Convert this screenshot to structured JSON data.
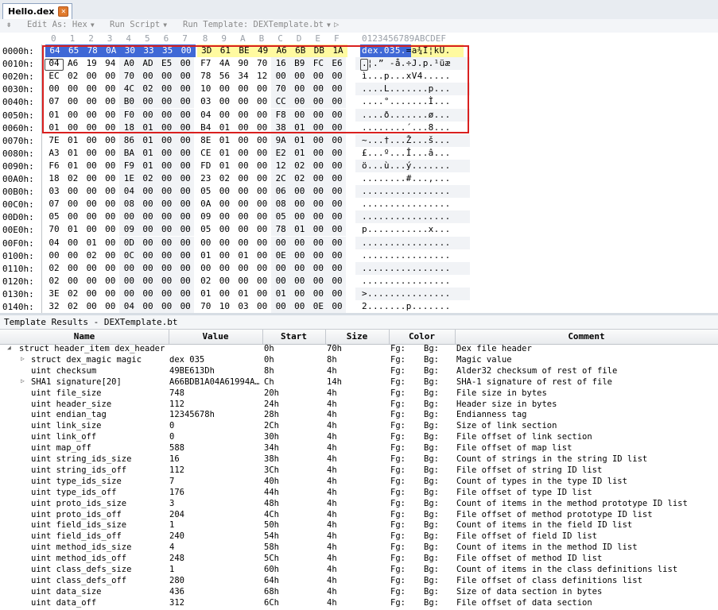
{
  "tab": {
    "title": "Hello.dex"
  },
  "toolbar": {
    "edit_as": "Edit As: Hex",
    "run_script": "Run Script",
    "run_template": "Run Template: DEXTemplate.bt"
  },
  "hex": {
    "column_headers": [
      "0",
      "1",
      "2",
      "3",
      "4",
      "5",
      "6",
      "7",
      "8",
      "9",
      "A",
      "B",
      "C",
      "D",
      "E",
      "F"
    ],
    "ascii_header": "0123456789ABCDEF",
    "rows": [
      {
        "addr": "0000h:",
        "bytes": [
          "64",
          "65",
          "78",
          "0A",
          "30",
          "33",
          "35",
          "00",
          "3D",
          "61",
          "BE",
          "49",
          "A6",
          "6B",
          "DB",
          "1A"
        ],
        "ascii": "dex.035.=a¾I¦kÛ."
      },
      {
        "addr": "0010h:",
        "bytes": [
          "04",
          "A6",
          "19",
          "94",
          "A0",
          "AD",
          "E5",
          "00",
          "F7",
          "4A",
          "90",
          "70",
          "16",
          "B9",
          "FC",
          "E6"
        ],
        "ascii": ".¦.” -å.÷J.p.¹üæ"
      },
      {
        "addr": "0020h:",
        "bytes": [
          "EC",
          "02",
          "00",
          "00",
          "70",
          "00",
          "00",
          "00",
          "78",
          "56",
          "34",
          "12",
          "00",
          "00",
          "00",
          "00"
        ],
        "ascii": "ì...p...xV4....."
      },
      {
        "addr": "0030h:",
        "bytes": [
          "00",
          "00",
          "00",
          "00",
          "4C",
          "02",
          "00",
          "00",
          "10",
          "00",
          "00",
          "00",
          "70",
          "00",
          "00",
          "00"
        ],
        "ascii": "....L.......p..."
      },
      {
        "addr": "0040h:",
        "bytes": [
          "07",
          "00",
          "00",
          "00",
          "B0",
          "00",
          "00",
          "00",
          "03",
          "00",
          "00",
          "00",
          "CC",
          "00",
          "00",
          "00"
        ],
        "ascii": "....°.......Ì..."
      },
      {
        "addr": "0050h:",
        "bytes": [
          "01",
          "00",
          "00",
          "00",
          "F0",
          "00",
          "00",
          "00",
          "04",
          "00",
          "00",
          "00",
          "F8",
          "00",
          "00",
          "00"
        ],
        "ascii": "....ð.......ø..."
      },
      {
        "addr": "0060h:",
        "bytes": [
          "01",
          "00",
          "00",
          "00",
          "18",
          "01",
          "00",
          "00",
          "B4",
          "01",
          "00",
          "00",
          "38",
          "01",
          "00",
          "00"
        ],
        "ascii": "........´...8..."
      },
      {
        "addr": "0070h:",
        "bytes": [
          "7E",
          "01",
          "00",
          "00",
          "86",
          "01",
          "00",
          "00",
          "8E",
          "01",
          "00",
          "00",
          "9A",
          "01",
          "00",
          "00"
        ],
        "ascii": "~...†...Ž...š..."
      },
      {
        "addr": "0080h:",
        "bytes": [
          "A3",
          "01",
          "00",
          "00",
          "BA",
          "01",
          "00",
          "00",
          "CE",
          "01",
          "00",
          "00",
          "E2",
          "01",
          "00",
          "00"
        ],
        "ascii": "£...º...Î...â..."
      },
      {
        "addr": "0090h:",
        "bytes": [
          "F6",
          "01",
          "00",
          "00",
          "F9",
          "01",
          "00",
          "00",
          "FD",
          "01",
          "00",
          "00",
          "12",
          "02",
          "00",
          "00"
        ],
        "ascii": "ö...ù...ý......."
      },
      {
        "addr": "00A0h:",
        "bytes": [
          "18",
          "02",
          "00",
          "00",
          "1E",
          "02",
          "00",
          "00",
          "23",
          "02",
          "00",
          "00",
          "2C",
          "02",
          "00",
          "00"
        ],
        "ascii": "........#...,..."
      },
      {
        "addr": "00B0h:",
        "bytes": [
          "03",
          "00",
          "00",
          "00",
          "04",
          "00",
          "00",
          "00",
          "05",
          "00",
          "00",
          "00",
          "06",
          "00",
          "00",
          "00"
        ],
        "ascii": "................"
      },
      {
        "addr": "00C0h:",
        "bytes": [
          "07",
          "00",
          "00",
          "00",
          "08",
          "00",
          "00",
          "00",
          "0A",
          "00",
          "00",
          "00",
          "08",
          "00",
          "00",
          "00"
        ],
        "ascii": "................"
      },
      {
        "addr": "00D0h:",
        "bytes": [
          "05",
          "00",
          "00",
          "00",
          "00",
          "00",
          "00",
          "00",
          "09",
          "00",
          "00",
          "00",
          "05",
          "00",
          "00",
          "00"
        ],
        "ascii": "................"
      },
      {
        "addr": "00E0h:",
        "bytes": [
          "70",
          "01",
          "00",
          "00",
          "09",
          "00",
          "00",
          "00",
          "05",
          "00",
          "00",
          "00",
          "78",
          "01",
          "00",
          "00"
        ],
        "ascii": "p...........x..."
      },
      {
        "addr": "00F0h:",
        "bytes": [
          "04",
          "00",
          "01",
          "00",
          "0D",
          "00",
          "00",
          "00",
          "00",
          "00",
          "00",
          "00",
          "00",
          "00",
          "00",
          "00"
        ],
        "ascii": "................"
      },
      {
        "addr": "0100h:",
        "bytes": [
          "00",
          "00",
          "02",
          "00",
          "0C",
          "00",
          "00",
          "00",
          "01",
          "00",
          "01",
          "00",
          "0E",
          "00",
          "00",
          "00"
        ],
        "ascii": "................"
      },
      {
        "addr": "0110h:",
        "bytes": [
          "02",
          "00",
          "00",
          "00",
          "00",
          "00",
          "00",
          "00",
          "00",
          "00",
          "00",
          "00",
          "00",
          "00",
          "00",
          "00"
        ],
        "ascii": "................"
      },
      {
        "addr": "0120h:",
        "bytes": [
          "02",
          "00",
          "00",
          "00",
          "00",
          "00",
          "00",
          "00",
          "02",
          "00",
          "00",
          "00",
          "00",
          "00",
          "00",
          "00"
        ],
        "ascii": "................"
      },
      {
        "addr": "0130h:",
        "bytes": [
          "3E",
          "02",
          "00",
          "00",
          "00",
          "00",
          "00",
          "00",
          "01",
          "00",
          "01",
          "00",
          "01",
          "00",
          "00",
          "00"
        ],
        "ascii": ">..............."
      },
      {
        "addr": "0140h:",
        "bytes": [
          "32",
          "02",
          "00",
          "00",
          "04",
          "00",
          "00",
          "00",
          "70",
          "10",
          "03",
          "00",
          "00",
          "00",
          "0E",
          "00"
        ],
        "ascii": "2.......p......."
      }
    ]
  },
  "template": {
    "title": "Template Results - DEXTemplate.bt",
    "columns": [
      "Name",
      "Value",
      "Start",
      "Size",
      "Color",
      "Comment"
    ],
    "rows": [
      {
        "name": "struct header_item dex_header",
        "value": "",
        "start": "0h",
        "size": "70h",
        "fg": "Fg:",
        "bg": "Bg:",
        "comment": "Dex file header",
        "indent": 0,
        "twisty": "open"
      },
      {
        "name": "struct dex_magic magic",
        "value": "dex 035",
        "start": "0h",
        "size": "8h",
        "fg": "Fg:",
        "bg": "Bg:",
        "comment": "Magic value",
        "indent": 1,
        "twisty": "closed"
      },
      {
        "name": "uint checksum",
        "value": "49BE613Dh",
        "start": "8h",
        "size": "4h",
        "fg": "Fg:",
        "bg": "Bg:",
        "comment": "Alder32 checksum of rest of file",
        "indent": 1,
        "twisty": ""
      },
      {
        "name": "SHA1 signature[20]",
        "value": "A66BDB1A04A61994A…",
        "start": "Ch",
        "size": "14h",
        "fg": "Fg:",
        "bg": "Bg:",
        "comment": "SHA-1 signature of rest of file",
        "indent": 1,
        "twisty": "closed"
      },
      {
        "name": "uint file_size",
        "value": "748",
        "start": "20h",
        "size": "4h",
        "fg": "Fg:",
        "bg": "Bg:",
        "comment": "File size in bytes",
        "indent": 1,
        "twisty": ""
      },
      {
        "name": "uint header_size",
        "value": "112",
        "start": "24h",
        "size": "4h",
        "fg": "Fg:",
        "bg": "Bg:",
        "comment": "Header size in bytes",
        "indent": 1,
        "twisty": ""
      },
      {
        "name": "uint endian_tag",
        "value": "12345678h",
        "start": "28h",
        "size": "4h",
        "fg": "Fg:",
        "bg": "Bg:",
        "comment": "Endianness tag",
        "indent": 1,
        "twisty": ""
      },
      {
        "name": "uint link_size",
        "value": "0",
        "start": "2Ch",
        "size": "4h",
        "fg": "Fg:",
        "bg": "Bg:",
        "comment": "Size of link section",
        "indent": 1,
        "twisty": ""
      },
      {
        "name": "uint link_off",
        "value": "0",
        "start": "30h",
        "size": "4h",
        "fg": "Fg:",
        "bg": "Bg:",
        "comment": "File offset of link section",
        "indent": 1,
        "twisty": ""
      },
      {
        "name": "uint map_off",
        "value": "588",
        "start": "34h",
        "size": "4h",
        "fg": "Fg:",
        "bg": "Bg:",
        "comment": "File offset of map list",
        "indent": 1,
        "twisty": ""
      },
      {
        "name": "uint string_ids_size",
        "value": "16",
        "start": "38h",
        "size": "4h",
        "fg": "Fg:",
        "bg": "Bg:",
        "comment": "Count of strings in the string ID list",
        "indent": 1,
        "twisty": ""
      },
      {
        "name": "uint string_ids_off",
        "value": "112",
        "start": "3Ch",
        "size": "4h",
        "fg": "Fg:",
        "bg": "Bg:",
        "comment": "File offset of string ID list",
        "indent": 1,
        "twisty": ""
      },
      {
        "name": "uint type_ids_size",
        "value": "7",
        "start": "40h",
        "size": "4h",
        "fg": "Fg:",
        "bg": "Bg:",
        "comment": "Count of types in the type ID list",
        "indent": 1,
        "twisty": ""
      },
      {
        "name": "uint type_ids_off",
        "value": "176",
        "start": "44h",
        "size": "4h",
        "fg": "Fg:",
        "bg": "Bg:",
        "comment": "File offset of type ID list",
        "indent": 1,
        "twisty": ""
      },
      {
        "name": "uint proto_ids_size",
        "value": "3",
        "start": "48h",
        "size": "4h",
        "fg": "Fg:",
        "bg": "Bg:",
        "comment": "Count of items in the method prototype ID list",
        "indent": 1,
        "twisty": ""
      },
      {
        "name": "uint proto_ids_off",
        "value": "204",
        "start": "4Ch",
        "size": "4h",
        "fg": "Fg:",
        "bg": "Bg:",
        "comment": "File offset of method prototype ID list",
        "indent": 1,
        "twisty": ""
      },
      {
        "name": "uint field_ids_size",
        "value": "1",
        "start": "50h",
        "size": "4h",
        "fg": "Fg:",
        "bg": "Bg:",
        "comment": "Count of items in the field ID list",
        "indent": 1,
        "twisty": ""
      },
      {
        "name": "uint field_ids_off",
        "value": "240",
        "start": "54h",
        "size": "4h",
        "fg": "Fg:",
        "bg": "Bg:",
        "comment": "File offset of field ID list",
        "indent": 1,
        "twisty": ""
      },
      {
        "name": "uint method_ids_size",
        "value": "4",
        "start": "58h",
        "size": "4h",
        "fg": "Fg:",
        "bg": "Bg:",
        "comment": "Count of items in the method ID list",
        "indent": 1,
        "twisty": ""
      },
      {
        "name": "uint method_ids_off",
        "value": "248",
        "start": "5Ch",
        "size": "4h",
        "fg": "Fg:",
        "bg": "Bg:",
        "comment": "File offset of method ID list",
        "indent": 1,
        "twisty": ""
      },
      {
        "name": "uint class_defs_size",
        "value": "1",
        "start": "60h",
        "size": "4h",
        "fg": "Fg:",
        "bg": "Bg:",
        "comment": "Count of items in the class definitions list",
        "indent": 1,
        "twisty": ""
      },
      {
        "name": "uint class_defs_off",
        "value": "280",
        "start": "64h",
        "size": "4h",
        "fg": "Fg:",
        "bg": "Bg:",
        "comment": "File offset of class definitions list",
        "indent": 1,
        "twisty": ""
      },
      {
        "name": "uint data_size",
        "value": "436",
        "start": "68h",
        "size": "4h",
        "fg": "Fg:",
        "bg": "Bg:",
        "comment": "Size of data section in bytes",
        "indent": 1,
        "twisty": ""
      },
      {
        "name": "uint data_off",
        "value": "312",
        "start": "6Ch",
        "size": "4h",
        "fg": "Fg:",
        "bg": "Bg:",
        "comment": "File offset of data section",
        "indent": 1,
        "twisty": ""
      }
    ]
  },
  "colors": {
    "selection_blue": "#3f68d6",
    "highlight_yellow": "#fffaa0",
    "annotation_red": "#d9201f"
  }
}
